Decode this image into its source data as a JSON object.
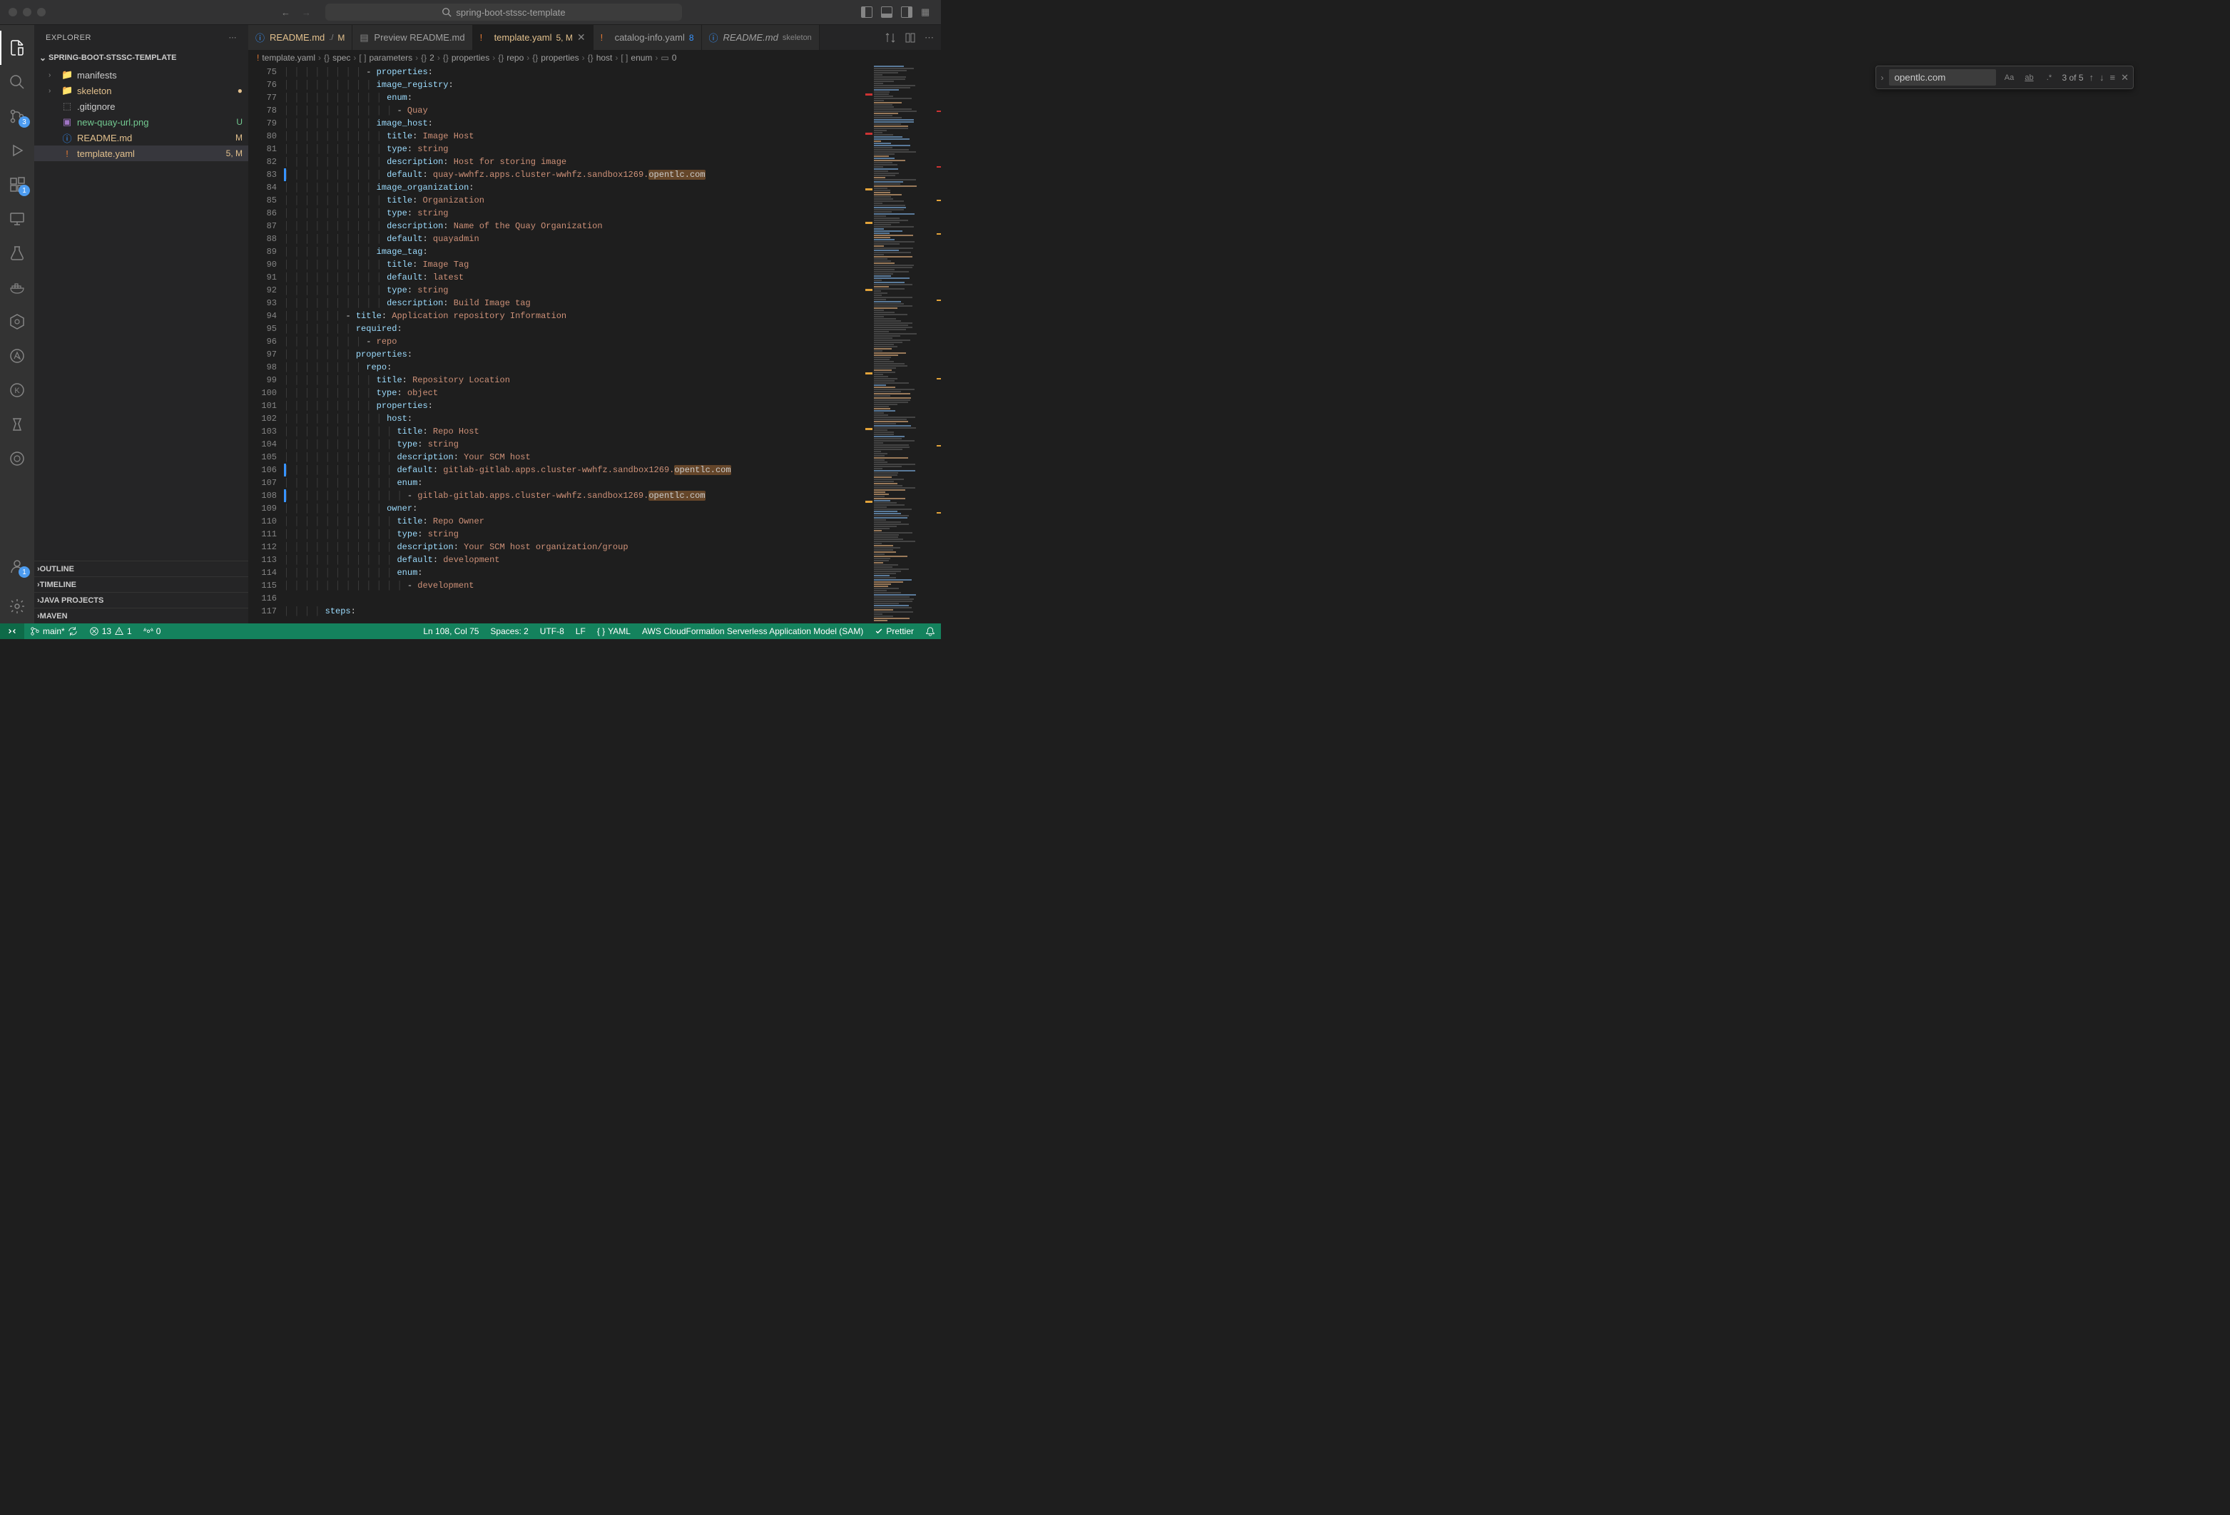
{
  "titlebar": {
    "project_name": "spring-boot-stssc-template"
  },
  "sidebar": {
    "title": "EXPLORER",
    "root": "SPRING-BOOT-STSSC-TEMPLATE",
    "items": [
      {
        "name": "manifests",
        "type": "folder"
      },
      {
        "name": "skeleton",
        "type": "folder",
        "modified": true,
        "dot": true
      },
      {
        "name": ".gitignore",
        "type": "file"
      },
      {
        "name": "new-quay-url.png",
        "type": "file",
        "modified": false,
        "status": "U",
        "untracked": true
      },
      {
        "name": "README.md",
        "type": "file",
        "modified": true,
        "status": "M"
      },
      {
        "name": "template.yaml",
        "type": "file",
        "modified": true,
        "status": "5, M",
        "selected": true
      }
    ],
    "collapsed": [
      "OUTLINE",
      "TIMELINE",
      "JAVA PROJECTS",
      "MAVEN"
    ]
  },
  "activity": {
    "scm_badge": "3",
    "ext_badge": "1",
    "accounts_badge": "1"
  },
  "tabs": [
    {
      "name": "README.md",
      "hint": "./",
      "badge": "M",
      "icon": "info"
    },
    {
      "name": "Preview README.md",
      "icon": "preview"
    },
    {
      "name": "template.yaml",
      "badge": "5, M",
      "active": true,
      "icon": "yaml",
      "close": true
    },
    {
      "name": "catalog-info.yaml",
      "badge2": "8",
      "icon": "yaml"
    },
    {
      "name": "README.md",
      "hint": "skeleton",
      "icon": "info",
      "italic": true
    }
  ],
  "breadcrumb": [
    "template.yaml",
    "spec",
    "parameters",
    "2",
    "properties",
    "repo",
    "properties",
    "host",
    "enum",
    "0"
  ],
  "breadcrumb_icons": [
    "!",
    "{}",
    "[ ]",
    "{}",
    "{}",
    "{}",
    "{}",
    "{}",
    "[ ]",
    "▭"
  ],
  "find": {
    "value": "opentlc.com",
    "result": "3 of 5"
  },
  "code": [
    {
      "n": 75,
      "indent": 8,
      "text": [
        [
          "punct",
          "- "
        ],
        [
          "key",
          "properties"
        ],
        [
          "punct",
          ":"
        ]
      ]
    },
    {
      "n": 76,
      "indent": 9,
      "text": [
        [
          "key",
          "image_registry"
        ],
        [
          "punct",
          ":"
        ]
      ]
    },
    {
      "n": 77,
      "indent": 10,
      "text": [
        [
          "key",
          "enum"
        ],
        [
          "punct",
          ":"
        ]
      ]
    },
    {
      "n": 78,
      "indent": 11,
      "text": [
        [
          "punct",
          "- "
        ],
        [
          "string",
          "Quay"
        ]
      ]
    },
    {
      "n": 79,
      "indent": 9,
      "text": [
        [
          "key",
          "image_host"
        ],
        [
          "punct",
          ":"
        ]
      ]
    },
    {
      "n": 80,
      "indent": 10,
      "text": [
        [
          "key",
          "title"
        ],
        [
          "punct",
          ": "
        ],
        [
          "string",
          "Image Host"
        ]
      ]
    },
    {
      "n": 81,
      "indent": 10,
      "text": [
        [
          "key",
          "type"
        ],
        [
          "punct",
          ": "
        ],
        [
          "string",
          "string"
        ]
      ]
    },
    {
      "n": 82,
      "indent": 10,
      "text": [
        [
          "key",
          "description"
        ],
        [
          "punct",
          ": "
        ],
        [
          "string",
          "Host for storing image"
        ]
      ]
    },
    {
      "n": 83,
      "indent": 10,
      "text": [
        [
          "key",
          "default"
        ],
        [
          "punct",
          ": "
        ],
        [
          "string",
          "quay-wwhfz.apps.cluster-wwhfz.sandbox1269."
        ],
        [
          "highlight",
          "opentlc.com"
        ]
      ],
      "mod": true
    },
    {
      "n": 84,
      "indent": 9,
      "text": [
        [
          "key",
          "image_organization"
        ],
        [
          "punct",
          ":"
        ]
      ]
    },
    {
      "n": 85,
      "indent": 10,
      "text": [
        [
          "key",
          "title"
        ],
        [
          "punct",
          ": "
        ],
        [
          "string",
          "Organization"
        ]
      ]
    },
    {
      "n": 86,
      "indent": 10,
      "text": [
        [
          "key",
          "type"
        ],
        [
          "punct",
          ": "
        ],
        [
          "string",
          "string"
        ]
      ]
    },
    {
      "n": 87,
      "indent": 10,
      "text": [
        [
          "key",
          "description"
        ],
        [
          "punct",
          ": "
        ],
        [
          "string",
          "Name of the Quay Organization"
        ]
      ]
    },
    {
      "n": 88,
      "indent": 10,
      "text": [
        [
          "key",
          "default"
        ],
        [
          "punct",
          ": "
        ],
        [
          "string",
          "quayadmin"
        ]
      ]
    },
    {
      "n": 89,
      "indent": 9,
      "text": [
        [
          "key",
          "image_tag"
        ],
        [
          "punct",
          ":"
        ]
      ]
    },
    {
      "n": 90,
      "indent": 10,
      "text": [
        [
          "key",
          "title"
        ],
        [
          "punct",
          ": "
        ],
        [
          "string",
          "Image Tag"
        ]
      ]
    },
    {
      "n": 91,
      "indent": 10,
      "text": [
        [
          "key",
          "default"
        ],
        [
          "punct",
          ": "
        ],
        [
          "string",
          "latest"
        ]
      ]
    },
    {
      "n": 92,
      "indent": 10,
      "text": [
        [
          "key",
          "type"
        ],
        [
          "punct",
          ": "
        ],
        [
          "string",
          "string"
        ]
      ]
    },
    {
      "n": 93,
      "indent": 10,
      "text": [
        [
          "key",
          "description"
        ],
        [
          "punct",
          ": "
        ],
        [
          "string",
          "Build Image tag"
        ]
      ]
    },
    {
      "n": 94,
      "indent": 6,
      "text": [
        [
          "punct",
          "- "
        ],
        [
          "key",
          "title"
        ],
        [
          "punct",
          ": "
        ],
        [
          "string",
          "Application repository Information"
        ]
      ]
    },
    {
      "n": 95,
      "indent": 7,
      "text": [
        [
          "key",
          "required"
        ],
        [
          "punct",
          ":"
        ]
      ]
    },
    {
      "n": 96,
      "indent": 8,
      "text": [
        [
          "punct",
          "- "
        ],
        [
          "string",
          "repo"
        ]
      ]
    },
    {
      "n": 97,
      "indent": 7,
      "text": [
        [
          "key",
          "properties"
        ],
        [
          "punct",
          ":"
        ]
      ]
    },
    {
      "n": 98,
      "indent": 8,
      "text": [
        [
          "key",
          "repo"
        ],
        [
          "punct",
          ":"
        ]
      ]
    },
    {
      "n": 99,
      "indent": 9,
      "text": [
        [
          "key",
          "title"
        ],
        [
          "punct",
          ": "
        ],
        [
          "string",
          "Repository Location"
        ]
      ]
    },
    {
      "n": 100,
      "indent": 9,
      "text": [
        [
          "key",
          "type"
        ],
        [
          "punct",
          ": "
        ],
        [
          "string",
          "object"
        ]
      ]
    },
    {
      "n": 101,
      "indent": 9,
      "text": [
        [
          "key",
          "properties"
        ],
        [
          "punct",
          ":"
        ]
      ]
    },
    {
      "n": 102,
      "indent": 10,
      "text": [
        [
          "key",
          "host"
        ],
        [
          "punct",
          ":"
        ]
      ]
    },
    {
      "n": 103,
      "indent": 11,
      "text": [
        [
          "key",
          "title"
        ],
        [
          "punct",
          ": "
        ],
        [
          "string",
          "Repo Host"
        ]
      ]
    },
    {
      "n": 104,
      "indent": 11,
      "text": [
        [
          "key",
          "type"
        ],
        [
          "punct",
          ": "
        ],
        [
          "string",
          "string"
        ]
      ]
    },
    {
      "n": 105,
      "indent": 11,
      "text": [
        [
          "key",
          "description"
        ],
        [
          "punct",
          ": "
        ],
        [
          "string",
          "Your SCM host"
        ]
      ]
    },
    {
      "n": 106,
      "indent": 11,
      "text": [
        [
          "key",
          "default"
        ],
        [
          "punct",
          ": "
        ],
        [
          "string",
          "gitlab-gitlab.apps.cluster-wwhfz.sandbox1269."
        ],
        [
          "highlight",
          "opentlc.com"
        ]
      ],
      "mod": true
    },
    {
      "n": 107,
      "indent": 11,
      "text": [
        [
          "key",
          "enum"
        ],
        [
          "punct",
          ":"
        ]
      ]
    },
    {
      "n": 108,
      "indent": 12,
      "text": [
        [
          "punct",
          "- "
        ],
        [
          "string",
          "gitlab-gitlab.apps.cluster-wwhfz.sandbox1269."
        ],
        [
          "highlight",
          "opentlc.com"
        ]
      ],
      "mod": true
    },
    {
      "n": 109,
      "indent": 10,
      "text": [
        [
          "key",
          "owner"
        ],
        [
          "punct",
          ":"
        ]
      ]
    },
    {
      "n": 110,
      "indent": 11,
      "text": [
        [
          "key",
          "title"
        ],
        [
          "punct",
          ": "
        ],
        [
          "string",
          "Repo Owner"
        ]
      ]
    },
    {
      "n": 111,
      "indent": 11,
      "text": [
        [
          "key",
          "type"
        ],
        [
          "punct",
          ": "
        ],
        [
          "string",
          "string"
        ]
      ]
    },
    {
      "n": 112,
      "indent": 11,
      "text": [
        [
          "key",
          "description"
        ],
        [
          "punct",
          ": "
        ],
        [
          "string",
          "Your SCM host organization/group"
        ]
      ]
    },
    {
      "n": 113,
      "indent": 11,
      "text": [
        [
          "key",
          "default"
        ],
        [
          "punct",
          ": "
        ],
        [
          "string",
          "development"
        ]
      ]
    },
    {
      "n": 114,
      "indent": 11,
      "text": [
        [
          "key",
          "enum"
        ],
        [
          "punct",
          ":"
        ]
      ]
    },
    {
      "n": 115,
      "indent": 12,
      "text": [
        [
          "punct",
          "- "
        ],
        [
          "string",
          "development"
        ]
      ]
    },
    {
      "n": 116,
      "indent": 0,
      "text": []
    },
    {
      "n": 117,
      "indent": 4,
      "text": [
        [
          "key",
          "steps"
        ],
        [
          "punct",
          ":"
        ]
      ]
    }
  ],
  "status": {
    "branch": "main*",
    "sync": "",
    "errors": "13",
    "warnings": "1",
    "ports": "0",
    "position": "Ln 108, Col 75",
    "spaces": "Spaces: 2",
    "encoding": "UTF-8",
    "eol": "LF",
    "lang": "YAML",
    "schema": "AWS CloudFormation Serverless Application Model (SAM)",
    "formatter": "Prettier"
  }
}
